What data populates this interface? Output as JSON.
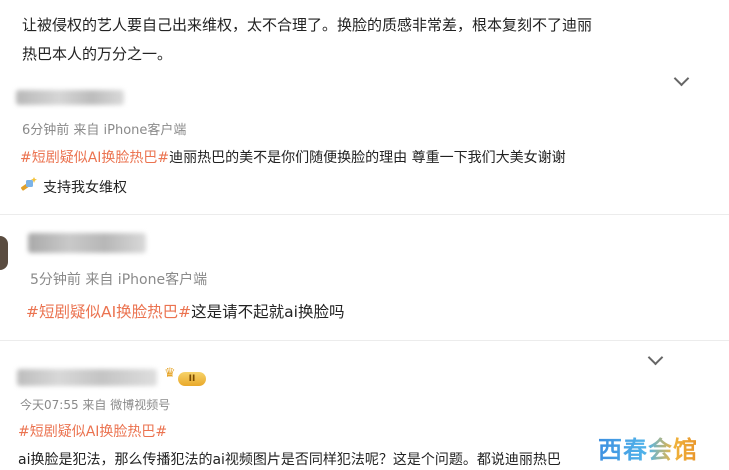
{
  "intro": {
    "line1": "让被侵权的艺人要自己出来维权，太不合理了。换脸的质感非常差，根本复刻不了迪丽",
    "line2": "热巴本人的万分之一。"
  },
  "comments": [
    {
      "meta": "6分钟前  来自 iPhone客户端",
      "tag": "#短剧疑似AI换脸热巴#",
      "text": "迪丽热巴的美不是你们随便换脸的理由 尊重一下我们大美女谢谢",
      "line2": "支持我女维权",
      "emoji": "sparkle-hammer-icon"
    },
    {
      "meta": "5分钟前  来自 iPhone客户端",
      "tag": "#短剧疑似AI换脸热巴#",
      "text": "这是请不起就ai换脸吗"
    },
    {
      "meta": "今天07:55  来自 微博视频号",
      "badge": "II",
      "tag": "#短剧疑似AI换脸热巴#",
      "line2": "ai换脸是犯法，那么传播犯法的ai视频图片是否同样犯法呢？这是个问题。都说迪丽热巴"
    }
  ],
  "watermark": "西春会馆",
  "colors": {
    "tag": "#eb7350",
    "meta": "#8a8a8a",
    "text": "#222222"
  }
}
